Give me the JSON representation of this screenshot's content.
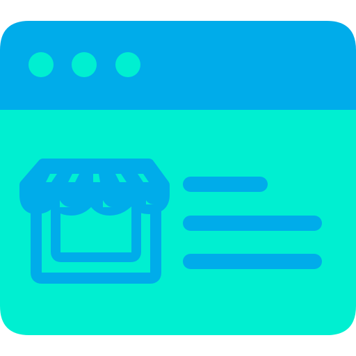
{
  "icon": {
    "name": "web-store-icon",
    "colors": {
      "header": "#00ACEA",
      "body": "#00EFD1",
      "dots": "#00EFD1",
      "store": "#00ACEA",
      "lines": "#00ACEA"
    },
    "window_dots": [
      "dot-1",
      "dot-2",
      "dot-3"
    ],
    "text_lines": [
      "line-1",
      "line-2",
      "line-3"
    ]
  }
}
